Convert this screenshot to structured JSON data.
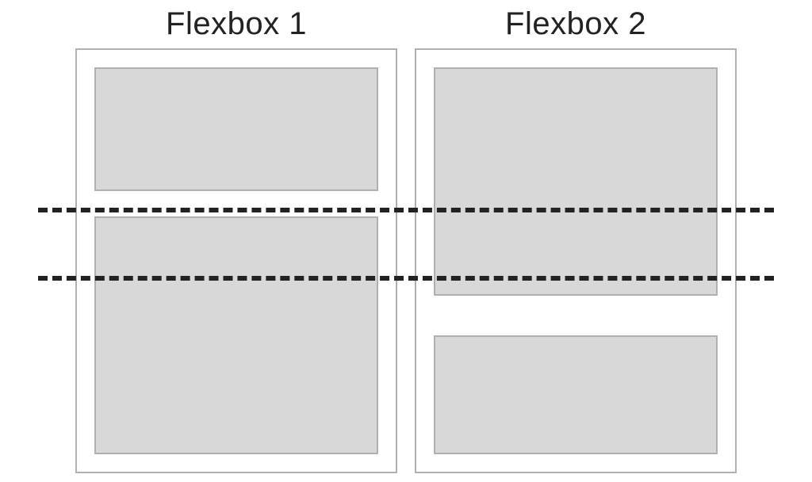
{
  "diagram": {
    "columns": [
      {
        "title": "Flexbox 1"
      },
      {
        "title": "Flexbox 2"
      }
    ]
  }
}
